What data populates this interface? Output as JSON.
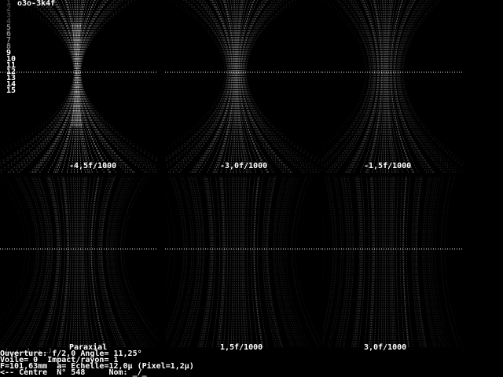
{
  "window": {
    "title": "o3o-3k4f"
  },
  "palette": {
    "background": "#000000",
    "text": "#ffffff",
    "level_dim": "#444444",
    "level_mid": "#888888",
    "level_bright": "#ffffff",
    "spot": "#dddddd",
    "axis": "#ffffff"
  },
  "levels": [
    "1",
    "2",
    "3",
    "4",
    "5",
    "6",
    "7",
    "8",
    "9",
    "10",
    "11",
    "12",
    "13",
    "14",
    "15"
  ],
  "panels": [
    {
      "label": "-4,5f/1000",
      "defocus": -4.5,
      "mode": "narrow"
    },
    {
      "label": "-3,0f/1000",
      "defocus": -3.0,
      "mode": "wide"
    },
    {
      "label": "-1,5f/1000",
      "defocus": -1.5,
      "mode": "wider"
    },
    {
      "label": "Paraxial",
      "defocus": 0.0,
      "mode": "flat"
    },
    {
      "label": "1,5f/1000",
      "defocus": 1.5,
      "mode": "flat2"
    },
    {
      "label": "3,0f/1000",
      "defocus": 3.0,
      "mode": "flat3"
    }
  ],
  "status": {
    "line1": "Ouverture: f/2,0 Angle= 11,25°",
    "line2": "Voile= 0  Impact/rayon= 1",
    "line3": "F=101,63mm  a= Echelle=12,0μ (Pixel=1,2μ)",
    "line4": "<-- Centre  N° 548     Nom: _/_"
  }
}
